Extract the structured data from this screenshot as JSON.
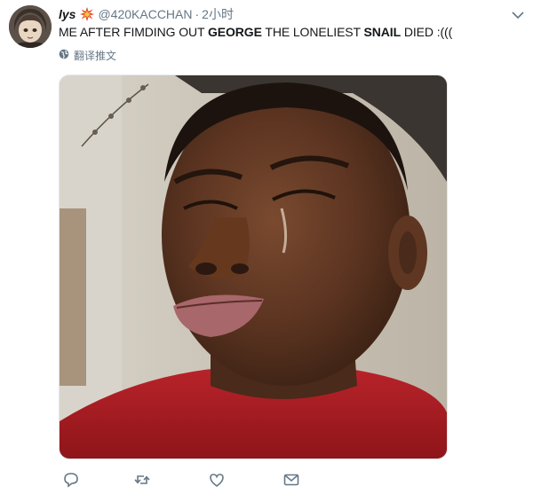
{
  "tweet": {
    "display_name": "lys",
    "badge_icon": "explosion-emoji-icon",
    "handle": "@420KACCHAN",
    "separator": "·",
    "time": "2小时",
    "text": {
      "p1": "ME AFTER FIMDING OUT ",
      "p2": "GEORGE",
      "p3": " THE LONELIEST ",
      "p4": "SNAIL",
      "p5": " DIED :((("
    },
    "translate_label": "翻译推文"
  },
  "actions": [
    "reply-icon",
    "retweet-icon",
    "like-icon",
    "message-icon"
  ],
  "colors": {
    "text": "#14171a",
    "secondary": "#657786",
    "border": "#e1e8ed"
  }
}
